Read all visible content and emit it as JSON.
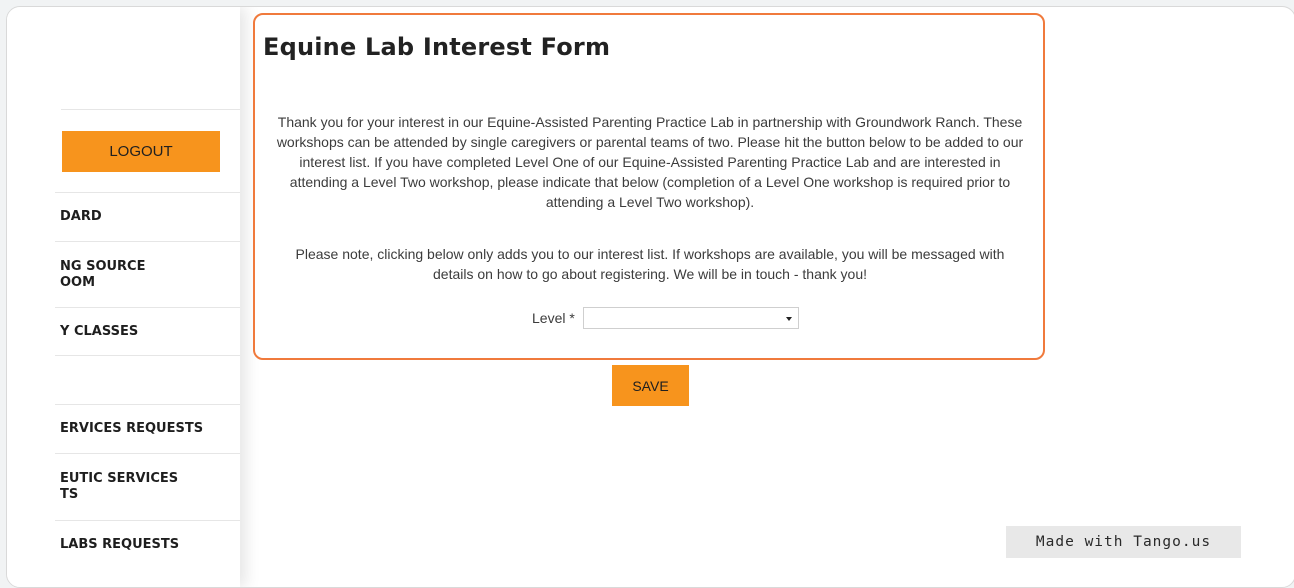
{
  "form": {
    "title": "Equine Lab Interest Form",
    "paragraph1": "Thank you for your interest in our Equine-Assisted Parenting Practice Lab in partnership with Groundwork Ranch. These workshops can be attended by single caregivers or parental teams of two. Please hit the button below to be added to our interest list. If you have completed Level One of our Equine-Assisted Parenting Practice Lab and are interested in attending a Level Two workshop, please indicate that below (completion of a Level One workshop is required prior to attending a Level Two workshop).",
    "paragraph2": "Please note, clicking below only adds you to our interest list. If workshops are available, you will be messaged with details on how to go about registering. We will be in touch - thank you!",
    "level_label": "Level *",
    "level_value": "",
    "save_label": "SAVE"
  },
  "sidebar": {
    "logout_label": "LOGOUT",
    "items": [
      {
        "label": " DARD"
      },
      {
        "label": "NG SOURCE\nOOM"
      },
      {
        "label": "Y CLASSES"
      },
      {
        "label": ""
      },
      {
        "label": "ERVICES REQUESTS"
      },
      {
        "label": "EUTIC SERVICES\nTS"
      },
      {
        "label": "LABS REQUESTS"
      }
    ]
  },
  "watermark": "Made with Tango.us",
  "colors": {
    "accent": "#f7941d",
    "panel_border": "#f07a3c"
  }
}
